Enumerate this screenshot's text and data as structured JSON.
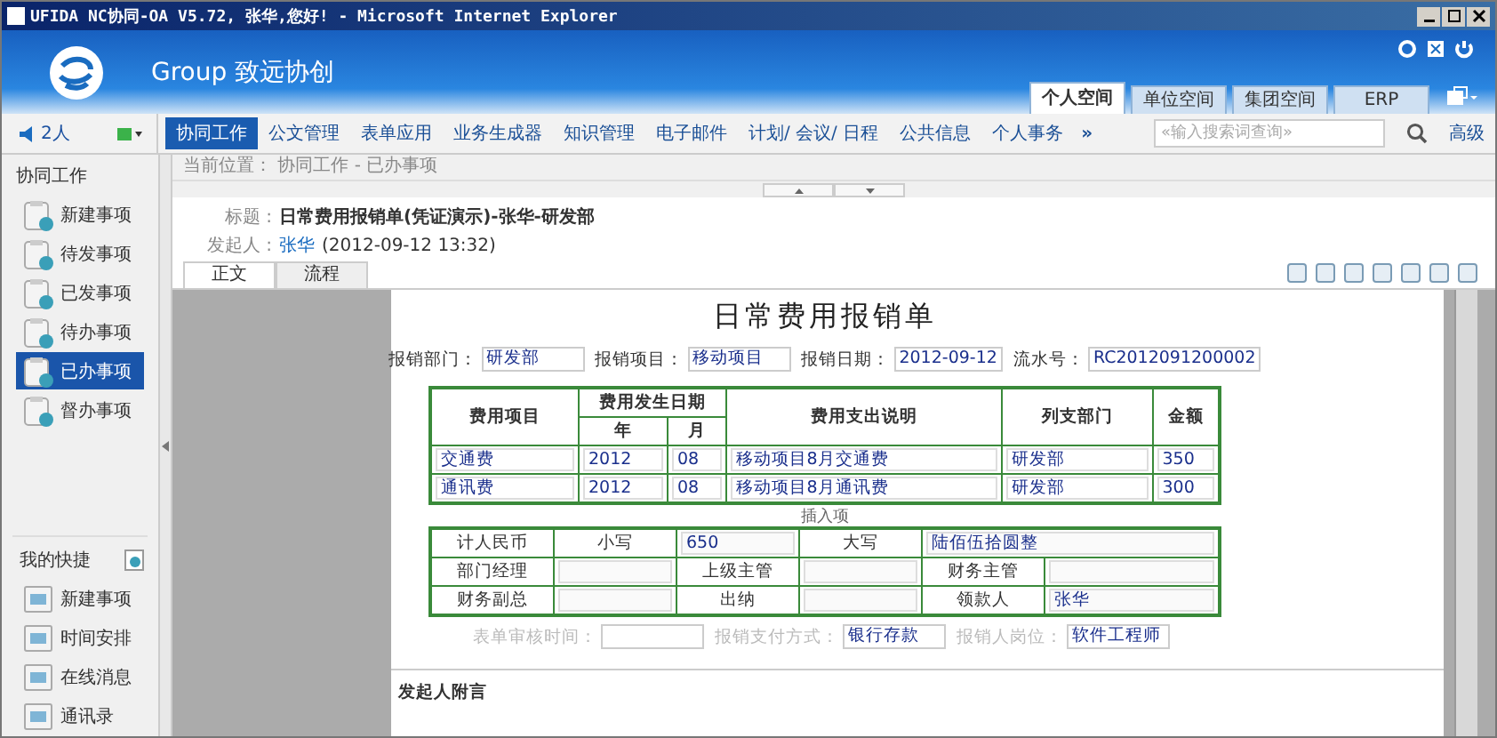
{
  "window": {
    "title": "UFIDA NC协同-OA V5.72, 张华,您好! - Microsoft Internet Explorer"
  },
  "header": {
    "brand": "Group 致远协创",
    "tabs": [
      {
        "label": "个人空间",
        "selected": true
      },
      {
        "label": "单位空间",
        "selected": false
      },
      {
        "label": "集团空间",
        "selected": false
      },
      {
        "label": "ERP",
        "selected": false
      }
    ]
  },
  "online": {
    "count": "2人"
  },
  "nav": {
    "items": [
      {
        "label": "协同工作",
        "selected": true
      },
      {
        "label": "公文管理",
        "selected": false
      },
      {
        "label": "表单应用",
        "selected": false
      },
      {
        "label": "业务生成器",
        "selected": false
      },
      {
        "label": "知识管理",
        "selected": false
      },
      {
        "label": "电子邮件",
        "selected": false
      },
      {
        "label": "计划/ 会议/ 日程",
        "selected": false
      },
      {
        "label": "公共信息",
        "selected": false
      },
      {
        "label": "个人事务",
        "selected": false
      }
    ],
    "more": "»",
    "search": {
      "placeholder": "«输入搜索词查询»"
    },
    "advanced": "高级"
  },
  "sidebar": {
    "title": "协同工作",
    "items": [
      {
        "label": "新建事项",
        "selected": false
      },
      {
        "label": "待发事项",
        "selected": false
      },
      {
        "label": "已发事项",
        "selected": false
      },
      {
        "label": "待办事项",
        "selected": false
      },
      {
        "label": "已办事项",
        "selected": true
      },
      {
        "label": "督办事项",
        "selected": false
      }
    ],
    "shortcuts_title": "我的快捷",
    "shortcuts": [
      "新建事项",
      "时间安排",
      "在线消息",
      "通讯录"
    ]
  },
  "breadcrumb": "当前位置： 协同工作 - 已办事项",
  "document": {
    "subject_label": "标题 :",
    "subject": "日常费用报销单(凭证演示)-张华-研发部",
    "sender_label": "发起人 :",
    "sender": "张华",
    "sent_time": "(2012-09-12 13:32)",
    "tabs": [
      {
        "label": "正文",
        "selected": true
      },
      {
        "label": "流程",
        "selected": false
      }
    ]
  },
  "form": {
    "title": "日常费用报销单",
    "fields": [
      {
        "label": "报销部门：",
        "value": "研发部"
      },
      {
        "label": "报销项目：",
        "value": "移动项目"
      },
      {
        "label": "报销日期：",
        "value": "2012-09-12"
      },
      {
        "label": "流水号：",
        "value": "RC2012091200002"
      }
    ],
    "table": {
      "columns": [
        {
          "label": "费用项目"
        },
        {
          "label": "费用发生日期",
          "colspan": 2
        },
        {
          "label": "费用支出说明"
        },
        {
          "label": "列支部门"
        },
        {
          "label": "金额"
        }
      ],
      "subcolumns": [
        "年",
        "月"
      ],
      "rows": [
        [
          "交通费",
          "2012",
          "08",
          "移动项目8月交通费",
          "研发部",
          "350"
        ],
        [
          "通讯费",
          "2012",
          "08",
          "移动项目8月通讯费",
          "研发部",
          "300"
        ]
      ]
    },
    "insert_label": "插入项",
    "total": {
      "label": "计人民币",
      "small_label": "小写",
      "small": "650",
      "big_label": "大写",
      "big": "陆佰伍拾圆整"
    },
    "approvals": [
      [
        {
          "label": "部门经理"
        },
        {
          "label": "上级主管"
        },
        {
          "label": "财务主管"
        }
      ],
      [
        {
          "label": "财务副总"
        },
        {
          "label": "出纳"
        },
        {
          "label": "领款人",
          "value": "张华"
        }
      ]
    ],
    "footer_fields": [
      {
        "label": "表单审核时间："
      },
      {
        "label": "报销支付方式：",
        "value": "银行存款"
      },
      {
        "label": "报销人岗位：",
        "value": "软件工程师"
      }
    ]
  },
  "note_title": "发起人附言"
}
